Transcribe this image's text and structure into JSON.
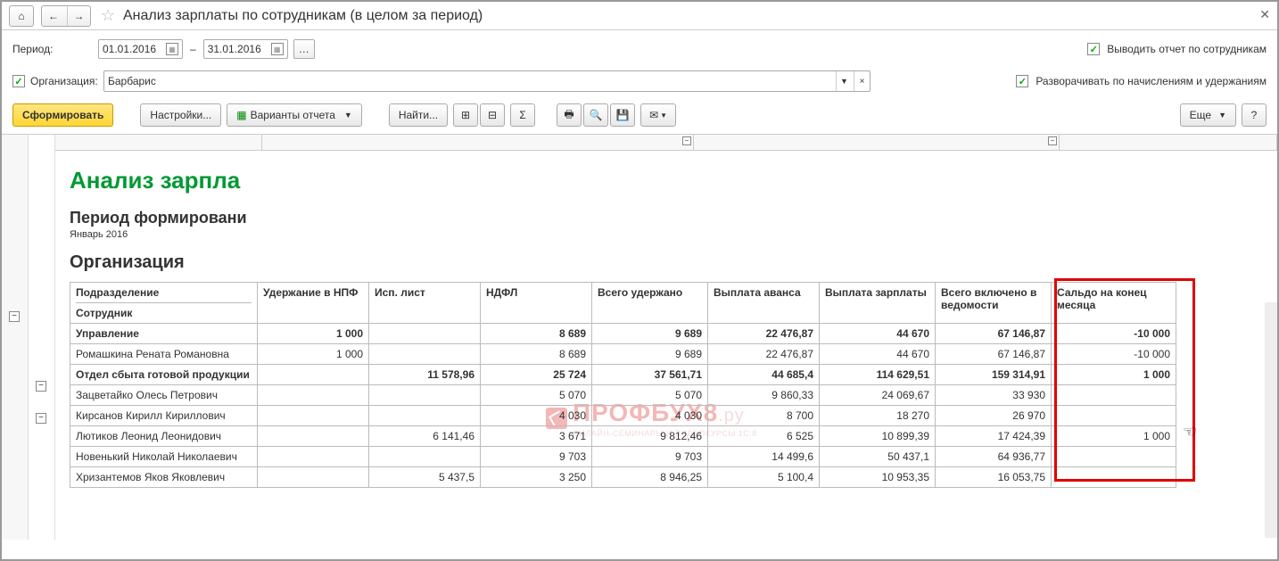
{
  "title": "Анализ зарплаты по сотрудникам (в целом за период)",
  "period_label": "Период:",
  "date_from": "01.01.2016",
  "date_to": "31.01.2016",
  "date_sep": "–",
  "checkbox_by_employees": "Выводить отчет по сотрудникам",
  "org_label": "Организация:",
  "org_value": "Барбарис",
  "checkbox_expand": "Разворачивать по начислениям и удержаниям",
  "toolbar": {
    "form": "Сформировать",
    "settings": "Настройки...",
    "variants": "Варианты отчета",
    "find": "Найти...",
    "more": "Еще"
  },
  "report": {
    "title": "Анализ зарпла",
    "period_title": "Период формировани",
    "period_value": "Январь 2016",
    "org_title": "Организация"
  },
  "headers": {
    "subdiv": "Подразделение",
    "employee": "Сотрудник",
    "npf": "Удержание в НПФ",
    "isp": "Исп. лист",
    "ndfl": "НДФЛ",
    "withheld": "Всего удержано",
    "advance": "Выплата аванса",
    "salary": "Выплата зарплаты",
    "included": "Всего включено в ведомости",
    "balance": "Сальдо на конец месяца"
  },
  "chart_data": {
    "type": "table",
    "columns": [
      "name",
      "npf",
      "isp",
      "ndfl",
      "withheld",
      "advance",
      "salary",
      "included",
      "balance"
    ],
    "rows": [
      {
        "name": "Управление",
        "npf": "1 000",
        "isp": "",
        "ndfl": "8 689",
        "withheld": "9 689",
        "advance": "22 476,87",
        "salary": "44 670",
        "included": "67 146,87",
        "balance": "-10 000",
        "bold": true
      },
      {
        "name": "Ромашкина Рената Романовна",
        "npf": "1 000",
        "isp": "",
        "ndfl": "8 689",
        "withheld": "9 689",
        "advance": "22 476,87",
        "salary": "44 670",
        "included": "67 146,87",
        "balance": "-10 000"
      },
      {
        "name": "Отдел сбыта готовой продукции",
        "npf": "",
        "isp": "11 578,96",
        "ndfl": "25 724",
        "withheld": "37 561,71",
        "advance": "44 685,4",
        "salary": "114 629,51",
        "included": "159 314,91",
        "balance": "1 000",
        "bold": true
      },
      {
        "name": "Зацветайко Олесь Петрович",
        "npf": "",
        "isp": "",
        "ndfl": "5 070",
        "withheld": "5 070",
        "advance": "9 860,33",
        "salary": "24 069,67",
        "included": "33 930",
        "balance": ""
      },
      {
        "name": "Кирсанов Кирилл Кириллович",
        "npf": "",
        "isp": "",
        "ndfl": "4 030",
        "withheld": "4 030",
        "advance": "8 700",
        "salary": "18 270",
        "included": "26 970",
        "balance": ""
      },
      {
        "name": "Лютиков Леонид Леонидович",
        "npf": "",
        "isp": "6 141,46",
        "ndfl": "3 671",
        "withheld": "9 812,46",
        "advance": "6 525",
        "salary": "10 899,39",
        "included": "17 424,39",
        "balance": "1 000"
      },
      {
        "name": "Новенький Николай Николаевич",
        "npf": "",
        "isp": "",
        "ndfl": "9 703",
        "withheld": "9 703",
        "advance": "14 499,6",
        "salary": "50 437,1",
        "included": "64 936,77",
        "balance": ""
      },
      {
        "name": "Хризантемов Яков Яковлевич",
        "npf": "",
        "isp": "5 437,5",
        "ndfl": "3 250",
        "withheld": "8 946,25",
        "advance": "5 100,4",
        "salary": "10 953,35",
        "included": "16 053,75",
        "balance": ""
      }
    ]
  }
}
